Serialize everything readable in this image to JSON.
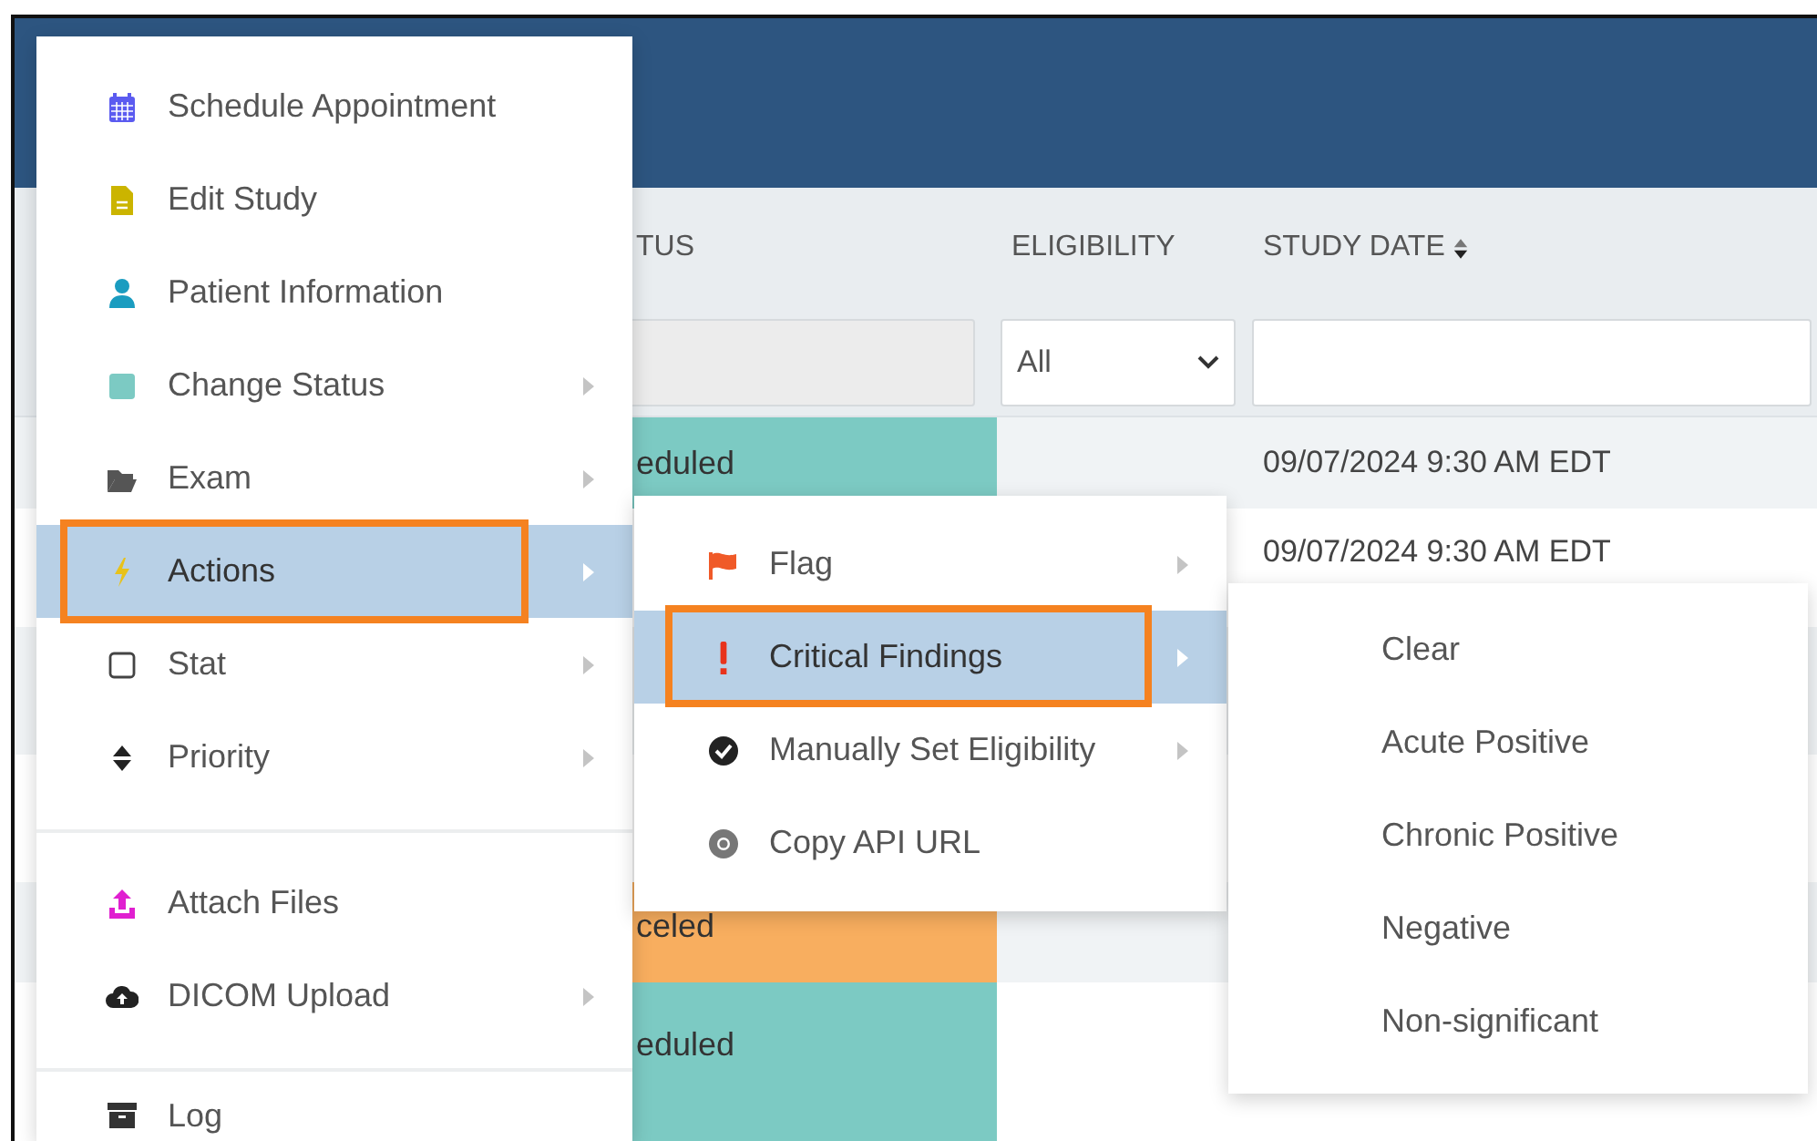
{
  "table": {
    "columns": [
      {
        "label": "TUS",
        "sortable": false
      },
      {
        "label": "ELIGIBILITY",
        "sortable": false
      },
      {
        "label": "STUDY DATE",
        "sortable": true
      }
    ],
    "filters": [
      {
        "kind": "text"
      },
      {
        "kind": "select",
        "value": "All"
      },
      {
        "kind": "text"
      }
    ],
    "rows": [
      {
        "status": "eduled",
        "color": "#7ccac3",
        "date": "09/07/2024 9:30 AM EDT"
      },
      {
        "date": "09/07/2024 9:30 AM EDT"
      },
      {},
      {},
      {
        "status": "celed",
        "color": "#f8ae5f"
      },
      {
        "status": "eduled",
        "color": "#7ccac3"
      }
    ]
  },
  "menus": [
    {
      "groups": [
        {
          "items": [
            {
              "label": "Schedule Appointment",
              "submenu": false,
              "selected": false,
              "highlighted": false
            },
            {
              "label": "Edit Study",
              "submenu": false,
              "selected": false,
              "highlighted": false
            },
            {
              "label": "Patient Information",
              "submenu": false,
              "selected": false,
              "highlighted": false
            },
            {
              "label": "Change Status",
              "submenu": true,
              "selected": false,
              "highlighted": false
            },
            {
              "label": "Exam",
              "submenu": true,
              "selected": false,
              "highlighted": false
            },
            {
              "label": "Actions",
              "submenu": true,
              "selected": true,
              "highlighted": true
            },
            {
              "label": "Stat",
              "submenu": true,
              "selected": false,
              "highlighted": false
            },
            {
              "label": "Priority",
              "submenu": true,
              "selected": false,
              "highlighted": false
            }
          ]
        },
        {
          "items": [
            {
              "label": "Attach Files",
              "submenu": false,
              "selected": false,
              "highlighted": false
            },
            {
              "label": "DICOM Upload",
              "submenu": true,
              "selected": false,
              "highlighted": false
            }
          ]
        },
        {
          "items": [
            {
              "label": "Log",
              "submenu": false,
              "selected": false,
              "highlighted": false
            }
          ]
        }
      ]
    },
    {
      "groups": [
        {
          "items": [
            {
              "label": "Flag",
              "submenu": true,
              "selected": false,
              "highlighted": false
            },
            {
              "label": "Critical Findings",
              "submenu": true,
              "selected": true,
              "highlighted": true
            },
            {
              "label": "Manually Set Eligibility",
              "submenu": true,
              "selected": false,
              "highlighted": false
            },
            {
              "label": "Copy API URL",
              "submenu": false,
              "selected": false,
              "highlighted": false
            }
          ]
        }
      ]
    },
    {
      "groups": [
        {
          "items": [
            {
              "label": "Clear",
              "selected": false,
              "highlighted": false
            },
            {
              "label": "Acute Positive",
              "selected": false,
              "highlighted": false
            },
            {
              "label": "Chronic Positive",
              "selected": false,
              "highlighted": false
            },
            {
              "label": "Negative",
              "selected": false,
              "highlighted": false
            },
            {
              "label": "Non-significant",
              "selected": false,
              "highlighted": false
            }
          ]
        }
      ]
    }
  ]
}
